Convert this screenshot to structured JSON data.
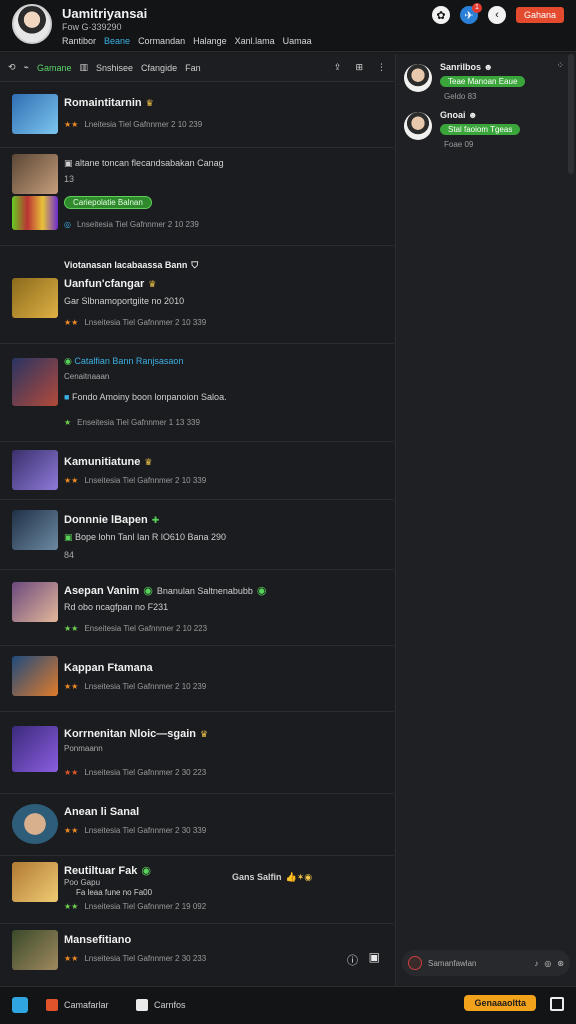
{
  "header": {
    "title": "Uamitriyansai",
    "subtitle": "Fow G·339290",
    "nav": [
      "Rantibor",
      "Beane",
      "Cormandan",
      "Halange",
      "Xanl.lama",
      "Uamaa"
    ],
    "active_nav": "Beane",
    "notification_count": "1",
    "action_button": "Gahana"
  },
  "toolbar": {
    "tabs": [
      "Gamane",
      "Snshisee",
      "Cfangide",
      "Fan"
    ],
    "active_tab": "Gamane"
  },
  "feed": [
    {
      "name": "Romaintitarnin",
      "meta": "Lneitesia  Tiel  Gafnnmer  2 10 239"
    },
    {
      "headline": "altane  toncan  flecandsabakan  Canag",
      "sub": "13",
      "pill": "Cariepolatie Balnan",
      "meta": "Lnseitesia  Tiel  Gafnnmer  2 10 239"
    },
    {
      "headline": "Viotanasan  lacabaassa  Bann",
      "name": "Uanfun'cfangar",
      "line": "Gar  Slbnamoportgiite  no  2010",
      "meta": "Lnseitesia  Tiel  Gafnnmer  2 10 339"
    },
    {
      "headline": "Catalfian  Bann  Ranjsasaon",
      "sub": "Cenaitnaaan",
      "line": "Fondo  Amoiny  boon  lonpanoion  Saloa.",
      "meta": "Enseitesia  Tiel  Gafnnmer  1 13 339"
    },
    {
      "name": "Kamunitiatune",
      "meta": "Lnseitesia  Tiel  Gafnnmer  2 10 339"
    },
    {
      "name": "Donnnie  lBapen",
      "line": "Bope  lohn  Tanl  Ian  R  lO610  Bana  290",
      "sub": "84",
      "meta": ""
    },
    {
      "name": "Asepan  Vanim",
      "extra": "Bnanulan  Saltnenabubb",
      "line": "Rd  obo  ncagfpan  no  F231",
      "meta": "Enseitesia  Tiel  Gafnnmer  2 10 223"
    },
    {
      "name": "Kappan  Ftamana",
      "meta": "Lnseitesia  Tiel  Gafnnmer  2 10 239"
    },
    {
      "name": "Korrnenitan  Nloic—sgain",
      "sub": "Ponmaann",
      "meta": "Lnseitesia  Tiel  Gafnnmer  2 30 223"
    },
    {
      "name": "Anean  li  Sanal",
      "meta": "Lnseitesia  Tiel  Gafnnmer  2 30 339"
    },
    {
      "name": "Reutiltuar  Fak",
      "sub": "Poo  Gapu",
      "line": "Fa  leaa  fune  no  Fa00",
      "aside": "Gans  Salfin",
      "meta": "Lnseitesia  Tiel  Gafnnmer  2 19 092"
    },
    {
      "name": "Mansefitiano",
      "meta": "Lnseitesia  Tiel  Gafnnmer  2 30 233"
    }
  ],
  "chat": [
    {
      "name": "Sanrilbos",
      "message": "Teae  Manoan  Eaue",
      "time": "Geldo  83"
    },
    {
      "name": "Gnoai",
      "message": "Stal  faoiom  Tgeas",
      "time": "Foae  09"
    }
  ],
  "chat_input": {
    "placeholder": "Samanfawlan"
  },
  "bottom": {
    "tab1": "Camafarlar",
    "tab2": "Carnfos",
    "cta": "Genaaaoltta"
  }
}
